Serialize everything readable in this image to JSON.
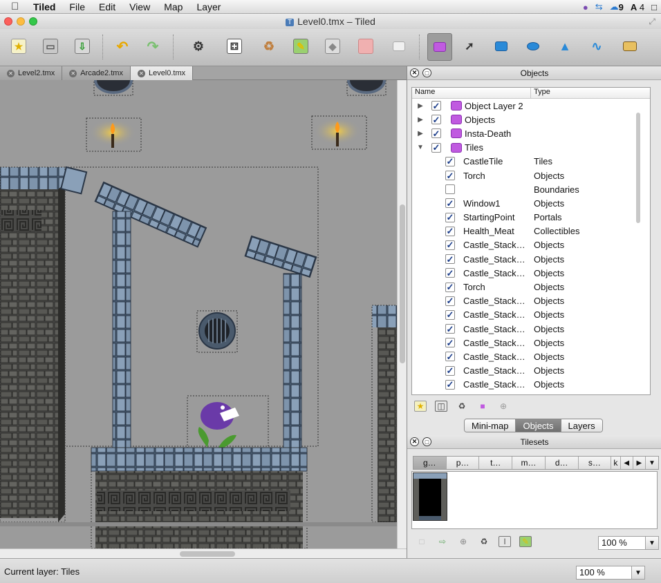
{
  "menubar": {
    "app": "Tiled",
    "items": [
      "File",
      "Edit",
      "View",
      "Map",
      "Layer"
    ],
    "tray": {
      "notifications": "9",
      "adobe": "4"
    }
  },
  "window": {
    "title": "Level0.tmx – Tiled"
  },
  "toolbar": {
    "buttons": [
      "new-map-icon",
      "open-icon",
      "save-icon",
      "undo-icon",
      "redo-icon",
      "random-mode-icon",
      "dice-icon",
      "stamp-brush-icon",
      "terrain-brush-icon",
      "bucket-fill-icon",
      "eraser-icon",
      "rectangular-select-icon",
      "select-objects-icon",
      "edit-polygons-icon",
      "insert-rectangle-icon",
      "insert-ellipse-icon",
      "insert-polygon-icon",
      "insert-polyline-icon",
      "insert-tile-icon"
    ],
    "accent": "#8a2fb0"
  },
  "tabs": [
    {
      "label": "Level2.tmx",
      "selected": false
    },
    {
      "label": "Arcade2.tmx",
      "selected": false
    },
    {
      "label": "Level0.tmx",
      "selected": true
    }
  ],
  "objects_panel": {
    "title": "Objects",
    "col_name": "Name",
    "col_type": "Type",
    "rows": [
      {
        "name": "Object Layer 2",
        "type": "",
        "level": 0,
        "expander": "▶",
        "checked": true,
        "layer": true
      },
      {
        "name": "Objects",
        "type": "",
        "level": 0,
        "expander": "▶",
        "checked": true,
        "layer": true
      },
      {
        "name": "Insta-Death",
        "type": "",
        "level": 0,
        "expander": "▶",
        "checked": true,
        "layer": true
      },
      {
        "name": "Tiles",
        "type": "",
        "level": 0,
        "expander": "▼",
        "checked": true,
        "layer": true
      },
      {
        "name": "CastleTile",
        "type": "Tiles",
        "level": 1,
        "checked": true
      },
      {
        "name": "Torch",
        "type": "Objects",
        "level": 1,
        "checked": true
      },
      {
        "name": "",
        "type": "Boundaries",
        "level": 1,
        "checked": false
      },
      {
        "name": "Window1",
        "type": "Objects",
        "level": 1,
        "checked": true
      },
      {
        "name": "StartingPoint",
        "type": "Portals",
        "level": 1,
        "checked": true
      },
      {
        "name": "Health_Meat",
        "type": "Collectibles",
        "level": 1,
        "checked": true
      },
      {
        "name": "Castle_Stack…",
        "type": "Objects",
        "level": 1,
        "checked": true
      },
      {
        "name": "Castle_Stack…",
        "type": "Objects",
        "level": 1,
        "checked": true
      },
      {
        "name": "Castle_Stack…",
        "type": "Objects",
        "level": 1,
        "checked": true
      },
      {
        "name": "Torch",
        "type": "Objects",
        "level": 1,
        "checked": true
      },
      {
        "name": "Castle_Stack…",
        "type": "Objects",
        "level": 1,
        "checked": true
      },
      {
        "name": "Castle_Stack…",
        "type": "Objects",
        "level": 1,
        "checked": true
      },
      {
        "name": "Castle_Stack…",
        "type": "Objects",
        "level": 1,
        "checked": true
      },
      {
        "name": "Castle_Stack…",
        "type": "Objects",
        "level": 1,
        "checked": true
      },
      {
        "name": "Castle_Stack…",
        "type": "Objects",
        "level": 1,
        "checked": true
      },
      {
        "name": "Castle_Stack…",
        "type": "Objects",
        "level": 1,
        "checked": true
      },
      {
        "name": "Castle_Stack…",
        "type": "Objects",
        "level": 1,
        "checked": true
      }
    ],
    "buttons": [
      "add-object-layer-icon",
      "duplicate-icon",
      "delete-icon",
      "move-to-layer-icon",
      "properties-icon"
    ]
  },
  "panel_tabs": {
    "items": [
      "Mini-map",
      "Objects",
      "Layers"
    ],
    "selected": "Objects"
  },
  "tilesets_panel": {
    "title": "Tilesets",
    "tabs": [
      "g…",
      "p…",
      "t…",
      "m…",
      "d…",
      "s…",
      "k"
    ],
    "selected": "g…",
    "zoom": "100 %",
    "buttons": [
      "new-tileset-icon",
      "import-tileset-icon",
      "export-tileset-icon",
      "remove-tileset-icon",
      "properties-icon",
      "edit-terrain-icon"
    ]
  },
  "statusbar": {
    "current_layer": "Current layer: Tiles",
    "zoom": "100 %"
  }
}
